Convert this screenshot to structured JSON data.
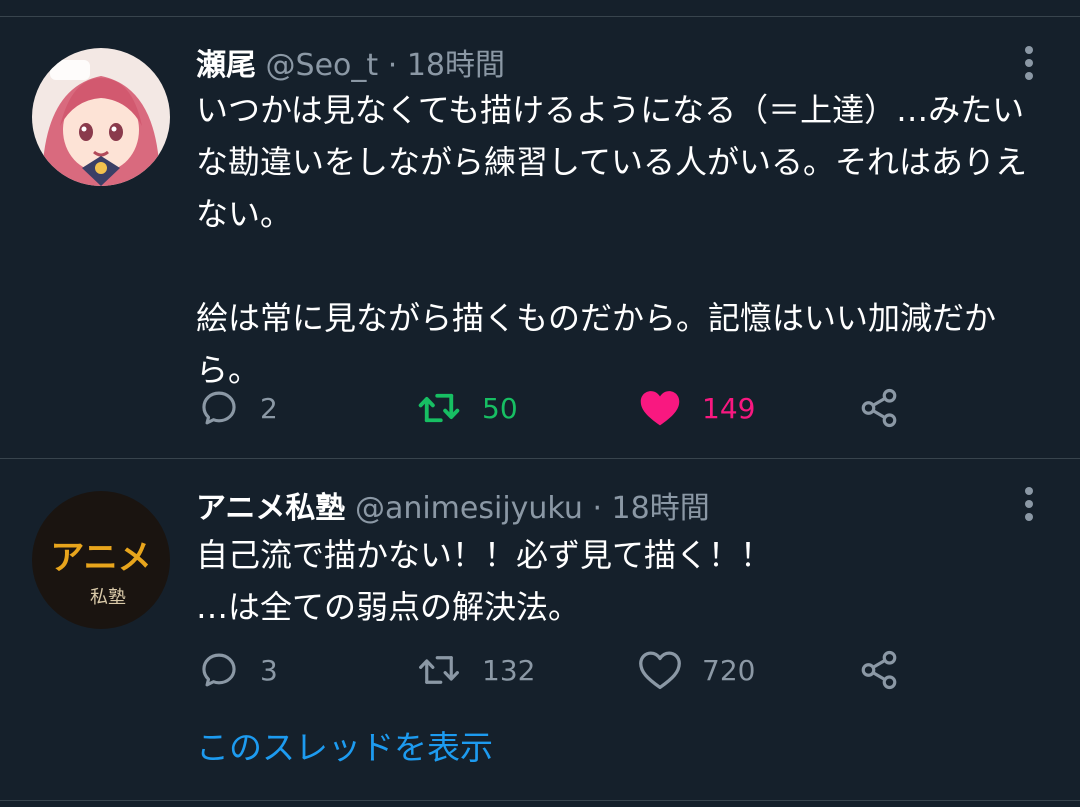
{
  "tweets": [
    {
      "name": "瀬尾",
      "handle": "@Seo_t",
      "separator": "·",
      "time": "18時間",
      "text": "いつかは見なくても描けるようになる（＝上達）…みたいな勘違いをしながら練習している人がいる。それはありえない。\n\n絵は常に見ながら描くものだから。記憶はいい加減だから。",
      "replies": "2",
      "retweets": "50",
      "likes": "149",
      "retweeted": true,
      "liked": true
    },
    {
      "name": "アニメ私塾",
      "handle": "@animesijyuku",
      "separator": "·",
      "time": "18時間",
      "text": "自己流で描かない！！必ず見て描く！！\n…は全ての弱点の解決法。",
      "replies": "3",
      "retweets": "132",
      "likes": "720",
      "retweeted": false,
      "liked": false,
      "avatar_text_main": "アニメ",
      "avatar_text_sub": "私塾"
    }
  ],
  "show_thread_label": "このスレッドを表示",
  "icons": {
    "reply": "reply-icon",
    "retweet": "retweet-icon",
    "like": "heart-icon",
    "share": "share-icon",
    "more": "more-vertical-icon"
  },
  "colors": {
    "background": "#15202b",
    "divider": "#38444d",
    "text_primary": "#ffffff",
    "text_secondary": "#8b98a5",
    "retweet_active": "#17bf63",
    "like_active": "#f91880",
    "link": "#1d9bf0"
  }
}
